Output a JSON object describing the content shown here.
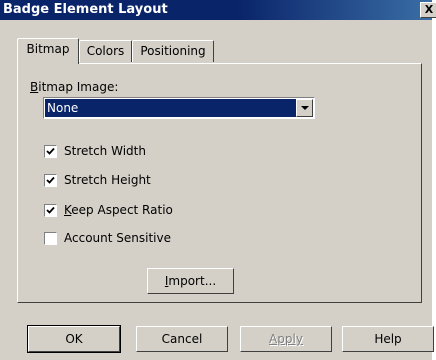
{
  "window": {
    "title": "Badge Element Layout",
    "close_glyph": "X"
  },
  "tabs": [
    {
      "label": "Bitmap",
      "active": true
    },
    {
      "label": "Colors",
      "active": false
    },
    {
      "label": "Positioning",
      "active": false
    }
  ],
  "bitmap": {
    "label_mnemonic": "B",
    "label_rest": "itmap Image:",
    "selected": "None"
  },
  "checkboxes": {
    "stretch_width": {
      "label": "Stretch Width",
      "checked": true
    },
    "stretch_height": {
      "label": "Stretch Height",
      "checked": true
    },
    "keep_aspect": {
      "mnemonic": "K",
      "label_rest": "eep Aspect Ratio",
      "checked": true
    },
    "account_sensitive": {
      "label": "Account Sensitive",
      "checked": false
    }
  },
  "import_button": {
    "mnemonic": "I",
    "label_rest": "mport..."
  },
  "footer": {
    "ok": "OK",
    "cancel": "Cancel",
    "apply": "Apply",
    "help": "Help"
  }
}
